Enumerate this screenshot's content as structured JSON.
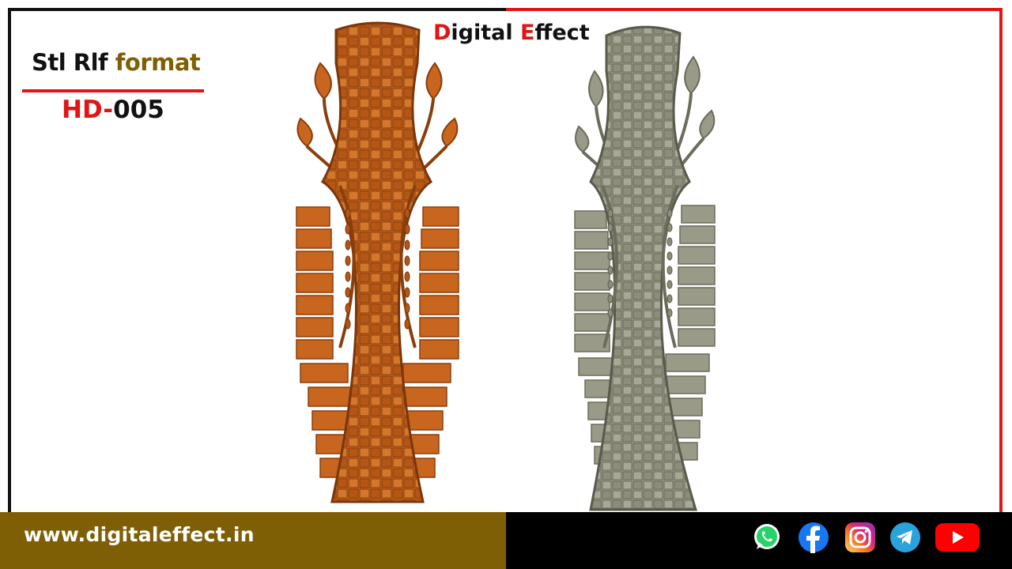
{
  "brand": {
    "first_letter": "D",
    "first_rest": "igital ",
    "second_letter": "E",
    "second_rest": "ffect"
  },
  "product": {
    "format_prefix": "Stl Rlf ",
    "format_accent": "format",
    "code_prefix": "HD-",
    "code_number": "005"
  },
  "footer": {
    "website": "www.digitaleffect.in"
  },
  "social_icons": [
    "whatsapp-icon",
    "facebook-icon",
    "instagram-icon",
    "telegram-icon",
    "youtube-icon"
  ],
  "colors": {
    "brand_red": "#e01515",
    "brand_gold": "#7f5f05",
    "wood": "#c8651e",
    "grey_render": "#9a9a88"
  }
}
